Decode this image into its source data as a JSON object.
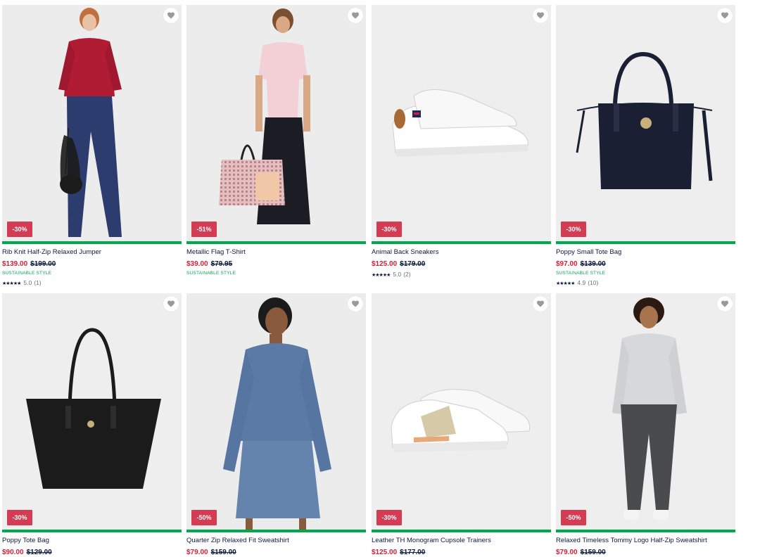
{
  "products": [
    {
      "name": "Rib Knit Half-Zip Relaxed Jumper",
      "price": "$139.00",
      "was": "$199.00",
      "discount": "-30%",
      "tag": "SUSTAINABLE STYLE",
      "stars": "★★★★★",
      "rating": "5.0",
      "count": "(1)"
    },
    {
      "name": "Metallic Flag T-Shirt",
      "price": "$39.00",
      "was": "$79.95",
      "discount": "-51%",
      "tag": "SUSTAINABLE STYLE"
    },
    {
      "name": "Animal Back Sneakers",
      "price": "$125.00",
      "was": "$179.00",
      "discount": "-30%",
      "stars": "★★★★★",
      "rating": "5.0",
      "count": "(2)"
    },
    {
      "name": "Poppy Small Tote Bag",
      "price": "$97.00",
      "was": "$139.00",
      "discount": "-30%",
      "tag": "SUSTAINABLE STYLE",
      "stars": "★★★★★",
      "rating": "4.9",
      "count": "(10)"
    },
    {
      "name": "Poppy Tote Bag",
      "price": "$90.00",
      "was": "$129.00",
      "discount": "-30%"
    },
    {
      "name": "Quarter Zip Relaxed Fit Sweatshirt",
      "price": "$79.00",
      "was": "$159.00",
      "discount": "-50%"
    },
    {
      "name": "Leather TH Monogram Cupsole Trainers",
      "price": "$125.00",
      "was": "$177.00",
      "discount": "-30%"
    },
    {
      "name": "Relaxed Timeless Tommy Logo Half-Zip Sweatshirt",
      "price": "$79.00",
      "was": "$159.00",
      "discount": "-50%"
    }
  ],
  "colors": {
    "accent_bar": "#00a94f",
    "discount_badge": "#d43c54",
    "sale_price": "#d3203a",
    "text": "#0e1a3d"
  },
  "icons": {
    "wishlist": "heart-icon"
  }
}
